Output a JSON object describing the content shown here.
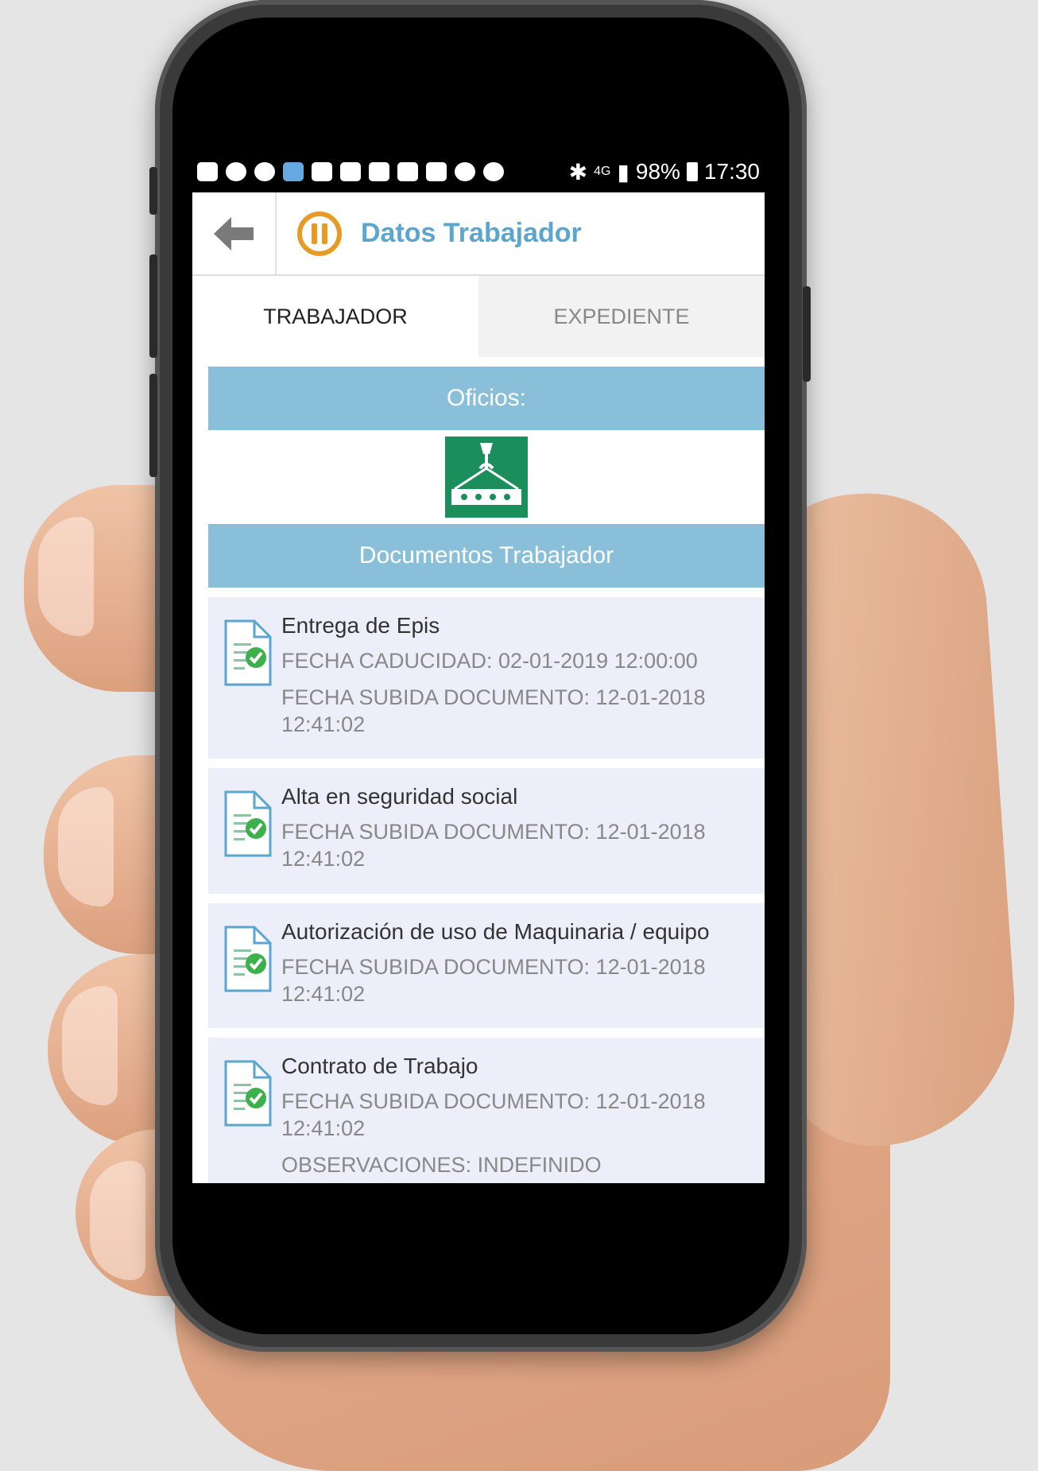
{
  "status_bar": {
    "battery": "98%",
    "time": "17:30",
    "network": "4G"
  },
  "app_bar": {
    "title": "Datos Trabajador"
  },
  "tabs": [
    {
      "label": "TRABAJADOR",
      "active": true
    },
    {
      "label": "EXPEDIENTE",
      "active": false
    }
  ],
  "sections": {
    "oficios_label": "Oficios:",
    "documentos_label": "Documentos Trabajador"
  },
  "documents": [
    {
      "title": "Entrega de Epis",
      "lines": [
        "FECHA CADUCIDAD: 02-01-2019 12:00:00",
        "FECHA SUBIDA DOCUMENTO: 12-01-2018 12:41:02"
      ]
    },
    {
      "title": "Alta en seguridad social",
      "lines": [
        "FECHA SUBIDA DOCUMENTO: 12-01-2018 12:41:02"
      ]
    },
    {
      "title": "Autorización de uso de Maquinaria / equipo",
      "lines": [
        "FECHA SUBIDA DOCUMENTO: 12-01-2018 12:41:02"
      ]
    },
    {
      "title": "Contrato de Trabajo",
      "lines": [
        "FECHA SUBIDA DOCUMENTO: 12-01-2018 12:41:02",
        "OBSERVACIONES: INDEFINIDO"
      ]
    }
  ],
  "icons": {
    "back": "arrow-left-icon",
    "pause": "pause-icon",
    "oficio": "crane-load-icon",
    "document": "document-check-icon"
  },
  "colors": {
    "title": "#5aa6cf",
    "section_bar": "#89bfd8",
    "pause": "#e79b27",
    "oficio_icon": "#1a8e5b",
    "doc_bg": "#eceef9"
  }
}
